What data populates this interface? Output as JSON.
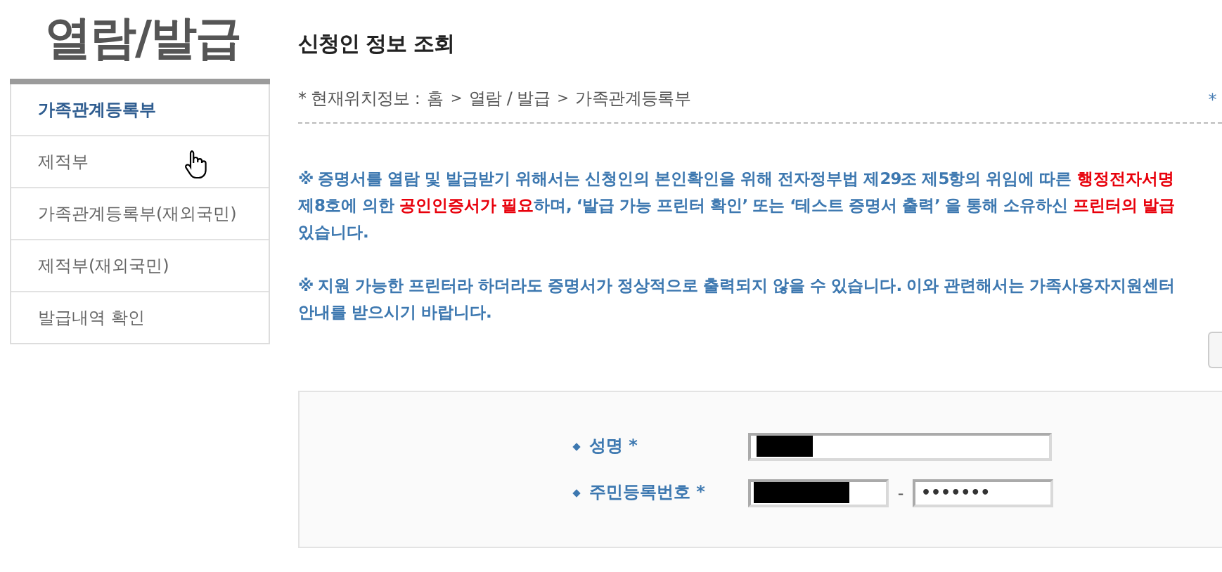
{
  "sidebar": {
    "title": "열람/발급",
    "items": [
      {
        "label": "가족관계등록부",
        "selected": true
      },
      {
        "label": "제적부",
        "selected": false
      },
      {
        "label": "가족관계등록부(재외국민)",
        "selected": false
      },
      {
        "label": "제적부(재외국민)",
        "selected": false
      },
      {
        "label": "발급내역 확인",
        "selected": false
      }
    ]
  },
  "page_title": "신청인 정보 조회",
  "breadcrumb": {
    "label": "* 현재위치정보 :",
    "path": [
      "홈",
      "열람 / 발급",
      "가족관계등록부"
    ],
    "separator": ">",
    "right_mark": "*"
  },
  "notices": [
    [
      [
        {
          "text": "※ 증명서를 열람 및 발급받기 위해서는 신청인의 본인확인을 위해 전자정부법 제29조 제5항의 위임에 따른 ",
          "kind": "normal"
        },
        {
          "text": "행정전자서명",
          "kind": "emphasis"
        }
      ],
      [
        {
          "text": "제8호에 의한 ",
          "kind": "normal"
        },
        {
          "text": "공인인증서가 필요",
          "kind": "emphasis"
        },
        {
          "text": "하며, ‘발급 가능 프린터 확인’ 또는 ‘테스트 증명서 출력’ 을 통해 소유하신 ",
          "kind": "normal"
        },
        {
          "text": "프린터의 발급",
          "kind": "emphasis"
        }
      ],
      [
        {
          "text": "있습니다.",
          "kind": "normal"
        }
      ]
    ],
    [
      [
        {
          "text": "※ 지원 가능한 프린터라 하더라도 증명서가 정상적으로 출력되지 않을 수 있습니다. 이와 관련해서는 가족사용자지원센터",
          "kind": "normal"
        }
      ],
      [
        {
          "text": "안내를 받으시기 바랍니다.",
          "kind": "normal"
        }
      ]
    ]
  ],
  "form": {
    "fields": [
      {
        "label": "성명 *",
        "kind": "name"
      },
      {
        "label": "주민등록번호 *",
        "kind": "resident_number",
        "separator": "-",
        "value": "•••••••"
      }
    ]
  }
}
